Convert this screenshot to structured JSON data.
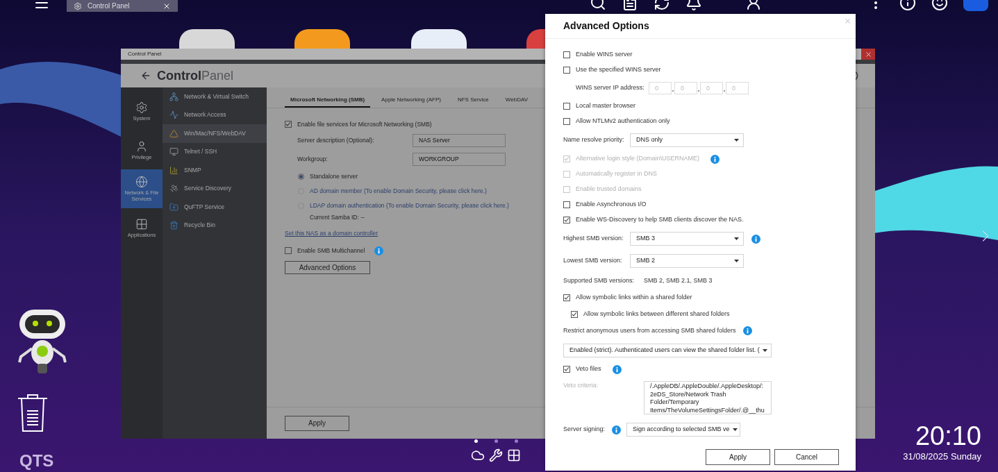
{
  "taskbar": {
    "app_tab": {
      "title": "Control Panel"
    }
  },
  "desktop": {
    "clock": "20:10",
    "date": "31/08/2025 Sunday",
    "brand": "QTS",
    "page_dots": [
      {
        "selected": true
      },
      {
        "selected": false
      },
      {
        "selected": false
      }
    ]
  },
  "control_panel": {
    "window_title": "Control Panel",
    "heading": {
      "bold": "Control",
      "light": "Panel"
    },
    "categories": [
      {
        "label": "System",
        "kind": "gear",
        "selected": false
      },
      {
        "label": "Privilege",
        "kind": "user",
        "selected": false
      },
      {
        "label": "Network & File Services",
        "kind": "globe",
        "selected": true
      },
      {
        "label": "Applications",
        "kind": "apps",
        "selected": false
      }
    ],
    "menu": [
      {
        "label": "Network & Virtual Switch",
        "kind": "switch",
        "selected": false
      },
      {
        "label": "Network Access",
        "kind": "access",
        "selected": false
      },
      {
        "label": "Win/Mac/NFS/WebDAV",
        "kind": "share",
        "selected": true
      },
      {
        "label": "Telnet / SSH",
        "kind": "terminal",
        "selected": false
      },
      {
        "label": "SNMP",
        "kind": "bars",
        "selected": false
      },
      {
        "label": "Service Discovery",
        "kind": "dish",
        "selected": false
      },
      {
        "label": "QuFTP Service",
        "kind": "ftp",
        "selected": false
      },
      {
        "label": "Recycle Bin",
        "kind": "bin",
        "selected": false
      }
    ],
    "tabs": [
      {
        "label": "Microsoft Networking (SMB)",
        "selected": true
      },
      {
        "label": "Apple Networking (AFP)",
        "selected": false
      },
      {
        "label": "NFS Service",
        "selected": false
      },
      {
        "label": "WebDAV",
        "selected": false
      }
    ],
    "enable_smb": {
      "label": "Enable file services for Microsoft Networking (SMB)",
      "checked": true
    },
    "fields": [
      {
        "label": "Server description (Optional):",
        "value": "NAS Server"
      },
      {
        "label": "Workgroup:",
        "value": "WORKGROUP"
      }
    ],
    "server_roles": [
      {
        "label": "Standalone server",
        "kind": "plain",
        "selected": true
      },
      {
        "label": "AD domain member (To enable Domain Security, please click here.)",
        "kind": "link",
        "selected": false
      },
      {
        "label": "LDAP domain authentication (To enable Domain Security, please click here.)",
        "kind": "link",
        "selected": false
      }
    ],
    "samba_id": "Current Samba ID: --",
    "domain_controller_link": "Set this NAS as a domain controller",
    "multichannel": {
      "label": "Enable SMB Multichannel",
      "checked": false
    },
    "advanced_button": "Advanced Options",
    "apply_button": "Apply"
  },
  "dialog": {
    "title": "Advanced Options",
    "options": [
      {
        "kind": "checkbox",
        "label": "Enable WINS server",
        "checked": false,
        "disabled": false
      },
      {
        "kind": "checkbox",
        "label": "Use the specified WINS server",
        "checked": false,
        "disabled": false
      },
      {
        "kind": "ip",
        "label": "WINS server IP address:",
        "octets": [
          {
            "placeholder": "0"
          },
          {
            "placeholder": "0"
          },
          {
            "placeholder": "0"
          },
          {
            "placeholder": "0"
          }
        ]
      },
      {
        "kind": "checkbox",
        "label": "Local master browser",
        "checked": false,
        "disabled": false
      },
      {
        "kind": "checkbox",
        "label": "Allow NTLMv2 authentication only",
        "checked": false,
        "disabled": false
      },
      {
        "kind": "select",
        "label": "Name resolve priority:",
        "value": "DNS only"
      },
      {
        "kind": "checkbox",
        "label": "Alternative login style (Domain\\USERNAME)",
        "checked": true,
        "disabled": true,
        "info": true
      },
      {
        "kind": "checkbox",
        "label": "Automatically register in DNS",
        "checked": false,
        "disabled": true
      },
      {
        "kind": "checkbox",
        "label": "Enable trusted domains",
        "checked": false,
        "disabled": true
      },
      {
        "kind": "checkbox",
        "label": "Enable Asynchronous I/O",
        "checked": false,
        "disabled": false
      },
      {
        "kind": "checkbox",
        "label": "Enable WS-Discovery to help SMB clients discover the NAS.",
        "checked": true,
        "disabled": false
      },
      {
        "kind": "select",
        "label": "Highest SMB version:",
        "value": "SMB 3",
        "info": true
      },
      {
        "kind": "select",
        "label": "Lowest SMB version:",
        "value": "SMB 2"
      },
      {
        "kind": "readout",
        "label": "Supported SMB versions:",
        "value": "SMB 2, SMB 2.1, SMB 3"
      },
      {
        "kind": "checkbox",
        "label": "Allow symbolic links within a shared folder",
        "checked": true,
        "disabled": false,
        "children": [
          {
            "kind": "checkbox",
            "label": "Allow symbolic links between different shared folders",
            "checked": true,
            "disabled": false
          }
        ]
      },
      {
        "kind": "note",
        "label": "Restrict anonymous users from accessing SMB shared folders",
        "info": true
      },
      {
        "kind": "select",
        "value": "Enabled (strict). Authenticated users can view the shared folder list. ("
      },
      {
        "kind": "checkbox",
        "label": "Veto files",
        "checked": true,
        "disabled": false,
        "info": true
      },
      {
        "kind": "textarea",
        "label": "Veto criteria:",
        "disabled": true,
        "lines": [
          "/.AppleDB/.AppleDouble/.AppleDesktop/:",
          "2eDS_Store/Network Trash",
          "Folder/Temporary",
          "Items/TheVolumeSettingsFolder/.@__thu"
        ]
      },
      {
        "kind": "select",
        "label": "Server signing:",
        "value": "Sign according to selected SMB ve",
        "info": true,
        "info_first": true
      }
    ],
    "buttons": [
      {
        "label": "Apply"
      },
      {
        "label": "Cancel"
      }
    ]
  }
}
